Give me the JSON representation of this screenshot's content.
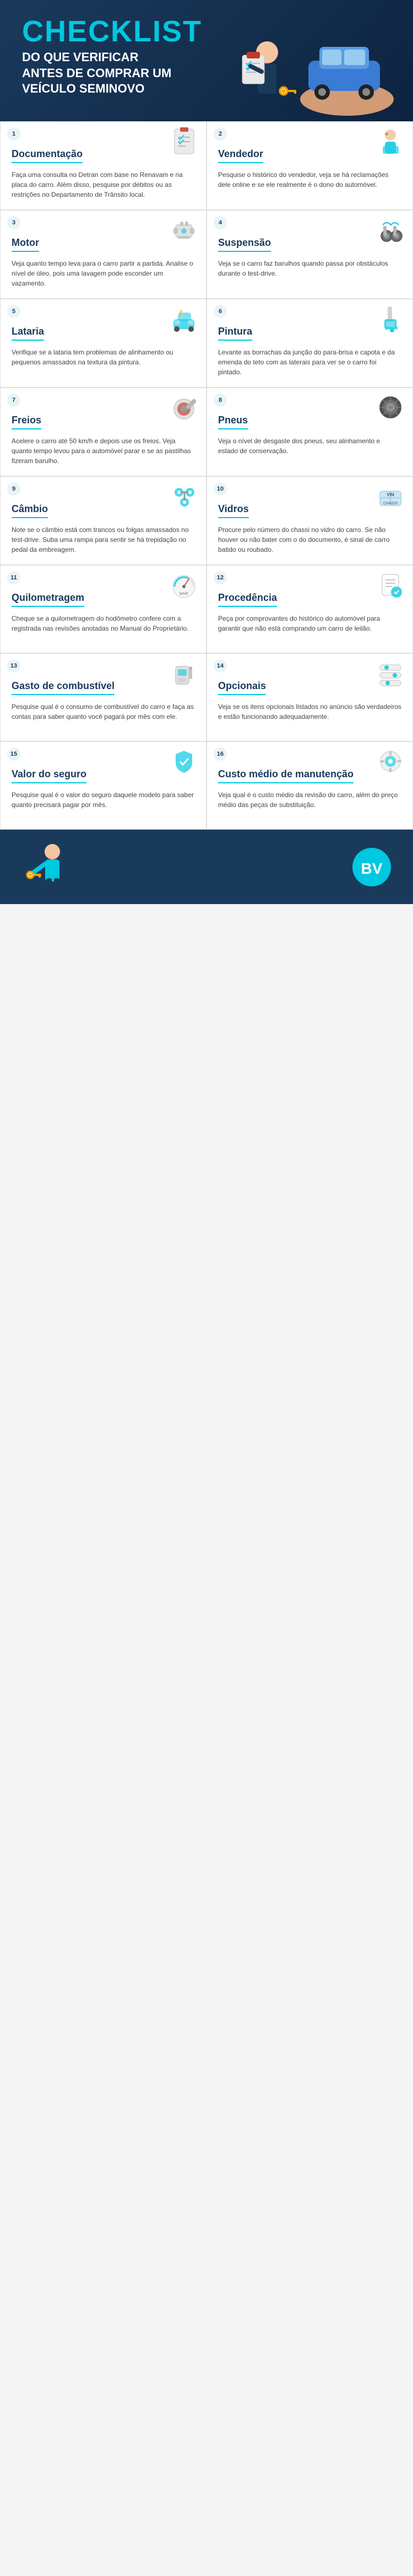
{
  "header": {
    "title": "CHECKLIST",
    "subtitle_line1": "DO QUE VERIFICAR",
    "subtitle_line2": "ANTES DE COMPRAR UM",
    "subtitle_line3": "VEÍCULO SEMINOVO"
  },
  "items": [
    {
      "number": "1",
      "title": "Documentação",
      "description": "Faça uma consulta no Detran com base no Renavam e na placa do carro. Além disso, pesquise por débitos ou as restrições no Departamento de Trânsito local.",
      "icon": "doc"
    },
    {
      "number": "2",
      "title": "Vendedor",
      "description": "Pesquise o histórico do vendedor, veja se há reclamações dele online e se ele realmente é o dono do automóvel.",
      "icon": "person"
    },
    {
      "number": "3",
      "title": "Motor",
      "description": "Veja quanto tempo leva para o carro partir a partida. Analise o nível de óleo, pois uma lavagem pode esconder um vazamento.",
      "icon": "engine"
    },
    {
      "number": "4",
      "title": "Suspensão",
      "description": "Veja se o carro faz barulhos quando passa por obstáculos durante o test-drive.",
      "icon": "suspension"
    },
    {
      "number": "5",
      "title": "Lataria",
      "description": "Verifique se a lataria tem problemas de alinhamento ou pequenos amassados na textura da pintura.",
      "icon": "bodywork"
    },
    {
      "number": "6",
      "title": "Pintura",
      "description": "Levante as borrachas da junção do para-brisa e capota e da emenda do teto com as laterais para ver se o carro foi pintado.",
      "icon": "paint"
    },
    {
      "number": "7",
      "title": "Freios",
      "description": "Acelere o carro até 50 km/h e depois use os freios. Veja quanto tempo levou para o automóvel parar e se as pastilhas fizeram barulho.",
      "icon": "brakes"
    },
    {
      "number": "8",
      "title": "Pneus",
      "description": "Veja o nível de desgaste dos pneus, seu alinhamento e estado de conservação.",
      "icon": "tires"
    },
    {
      "number": "9",
      "title": "Câmbio",
      "description": "Note se o câmbio está com trancos ou folgas amassados no test-drive. Suba uma rampa para sentir se há trepidação no pedal da embreagem.",
      "icon": "gearbox"
    },
    {
      "number": "10",
      "title": "Vidros",
      "description": "Procure pelo número do chassi no vidro do carro. Se não houver ou não bater com o do documento, é sinal de carro batido ou roubado.",
      "icon": "glass"
    },
    {
      "number": "11",
      "title": "Quilometragem",
      "description": "Cheque se a quilometragem do hodômetro confere com a registrada nas revisões anotadas no Manual do Proprietário.",
      "icon": "odometer"
    },
    {
      "number": "12",
      "title": "Procedência",
      "description": "Peça por comprovantes do histórico do automóvel para garantir que não está comprando um carro de leilão.",
      "icon": "history"
    },
    {
      "number": "13",
      "title": "Gasto de combustível",
      "description": "Pesquise qual é o consumo de combustível do carro e faça as contas para saber quanto você pagará por mês com ele.",
      "icon": "fuel"
    },
    {
      "number": "14",
      "title": "Opcionais",
      "description": "Veja se os itens opcionais listados no anúncio são verdadeiros e estão funcionando adequadamente.",
      "icon": "options"
    },
    {
      "number": "15",
      "title": "Valor do seguro",
      "description": "Pesquise qual é o valor do seguro daquele modelo para saber quanto precisará pagar por mês.",
      "icon": "insurance"
    },
    {
      "number": "16",
      "title": "Custo médio de manutenção",
      "description": "Veja qual é o custo médio da revisão do carro, além do preço médio das peças de substituição.",
      "icon": "maintenance"
    }
  ],
  "footer": {
    "logo_letters": "BV"
  },
  "colors": {
    "accent": "#00c8e0",
    "dark": "#1a3a5c",
    "text": "#444444",
    "light_bg": "#e8f4f8"
  }
}
